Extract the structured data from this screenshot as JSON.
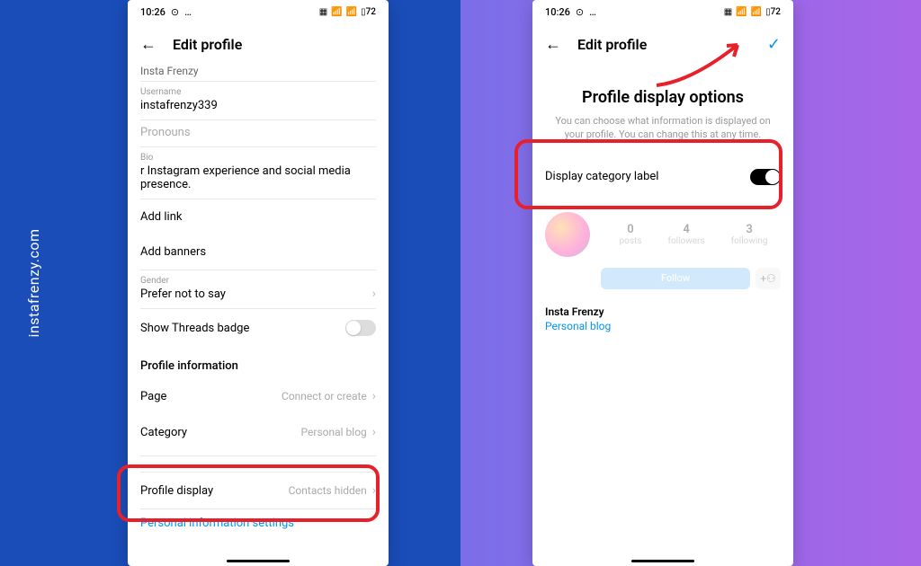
{
  "watermark": "instafrenzy.com",
  "statusbar": {
    "time": "10:26",
    "battery": "72"
  },
  "phone1": {
    "header": {
      "title": "Edit profile"
    },
    "truncated_name": "Insta Frenzy",
    "fields": {
      "username": {
        "label": "Username",
        "value": "instafrenzy339"
      },
      "pronouns": {
        "label": "Pronouns",
        "value": ""
      },
      "bio": {
        "label": "Bio",
        "value": "r Instagram experience and social media presence."
      }
    },
    "links": {
      "add_link": "Add link",
      "add_banners": "Add banners"
    },
    "gender": {
      "label": "Gender",
      "value": "Prefer not to say"
    },
    "threads": {
      "label": "Show Threads badge"
    },
    "section_profile_info": "Profile information",
    "page_row": {
      "label": "Page",
      "value": "Connect or create"
    },
    "category_row": {
      "label": "Category",
      "value": "Personal blog"
    },
    "profile_display_row": {
      "label": "Profile display",
      "value": "Contacts hidden"
    },
    "personal_info_link": "Personal information settings"
  },
  "phone2": {
    "header": {
      "title": "Edit profile"
    },
    "page_title": "Profile display options",
    "subtitle": "You can choose what information is displayed on your profile. You can change this at any time.",
    "toggle_row": {
      "label": "Display category label"
    },
    "preview": {
      "stats": [
        {
          "num": "0",
          "label": "posts"
        },
        {
          "num": "4",
          "label": "followers"
        },
        {
          "num": "3",
          "label": "following"
        }
      ],
      "follow": "Follow"
    },
    "profile": {
      "name": "Insta Frenzy",
      "category": "Personal blog"
    }
  }
}
